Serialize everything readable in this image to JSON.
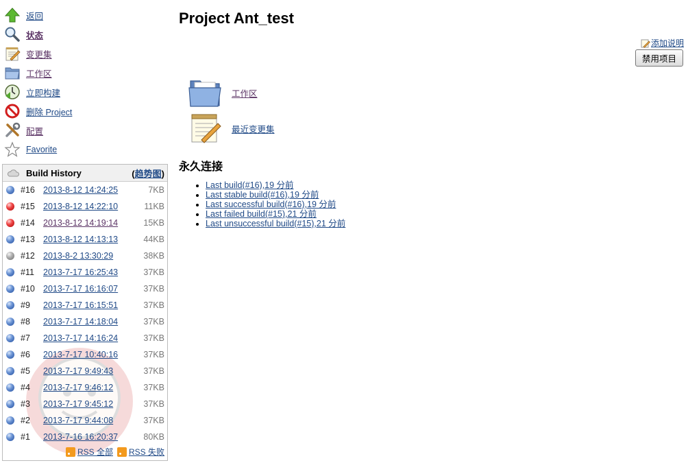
{
  "sidebar": {
    "items": [
      {
        "label": "返回",
        "icon": "up-arrow-icon"
      },
      {
        "label": "状态",
        "icon": "search-icon"
      },
      {
        "label": "变更集",
        "icon": "notepad-icon"
      },
      {
        "label": "工作区",
        "icon": "folder-icon"
      },
      {
        "label": "立即构建",
        "icon": "clock-icon"
      },
      {
        "label": "删除 Project",
        "icon": "no-entry-icon"
      },
      {
        "label": "配置",
        "icon": "tools-icon"
      },
      {
        "label": "Favorite",
        "icon": "star-icon"
      }
    ]
  },
  "build_history": {
    "title": "Build History",
    "trend_open": "(",
    "trend_label": "趋势图",
    "trend_close": ")",
    "builds": [
      {
        "num": "#16",
        "date": "2013-8-12 14:24:25",
        "size": "7KB",
        "status": "blue"
      },
      {
        "num": "#15",
        "date": "2013-8-12 14:22:10",
        "size": "11KB",
        "status": "red"
      },
      {
        "num": "#14",
        "date": "2013-8-12 14:19:14",
        "size": "15KB",
        "status": "red"
      },
      {
        "num": "#13",
        "date": "2013-8-12 14:13:13",
        "size": "44KB",
        "status": "blue"
      },
      {
        "num": "#12",
        "date": "2013-8-2 13:30:29",
        "size": "38KB",
        "status": "grey"
      },
      {
        "num": "#11",
        "date": "2013-7-17 16:25:43",
        "size": "37KB",
        "status": "blue"
      },
      {
        "num": "#10",
        "date": "2013-7-17 16:16:07",
        "size": "37KB",
        "status": "blue"
      },
      {
        "num": "#9",
        "date": "2013-7-17 16:15:51",
        "size": "37KB",
        "status": "blue"
      },
      {
        "num": "#8",
        "date": "2013-7-17 14:18:04",
        "size": "37KB",
        "status": "blue"
      },
      {
        "num": "#7",
        "date": "2013-7-17 14:16:24",
        "size": "37KB",
        "status": "blue"
      },
      {
        "num": "#6",
        "date": "2013-7-17 10:40:16",
        "size": "37KB",
        "status": "blue"
      },
      {
        "num": "#5",
        "date": "2013-7-17 9:49:43",
        "size": "37KB",
        "status": "blue"
      },
      {
        "num": "#4",
        "date": "2013-7-17 9:46:12",
        "size": "37KB",
        "status": "blue"
      },
      {
        "num": "#3",
        "date": "2013-7-17 9:45:12",
        "size": "37KB",
        "status": "blue"
      },
      {
        "num": "#2",
        "date": "2013-7-17 9:44:08",
        "size": "37KB",
        "status": "blue"
      },
      {
        "num": "#1",
        "date": "2013-7-16 16:20:37",
        "size": "80KB",
        "status": "blue"
      }
    ],
    "rss_all": "RSS 全部",
    "rss_failed": "RSS 失败"
  },
  "main": {
    "title": "Project Ant_test",
    "add_description": "添加说明",
    "disable_button": "禁用项目",
    "workspace_label": "工作区",
    "recent_changes_label": "最近变更集",
    "permalinks_heading": "永久连接",
    "permalinks": [
      "Last build(#16),19 分前",
      "Last stable build(#16),19 分前",
      "Last successful build(#16),19 分前",
      "Last failed build(#15),21 分前",
      "Last unsuccessful build(#15),21 分前"
    ]
  },
  "colors": {
    "link": "#204a87",
    "visited_link": "#5c3566",
    "blue_ball": "#1f4c9e",
    "red_ball": "#e02020",
    "grey_ball": "#9a9a9a"
  }
}
